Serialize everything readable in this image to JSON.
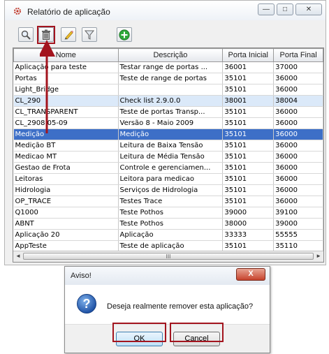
{
  "window": {
    "title": "Relatório de aplicação",
    "minimize_glyph": "—",
    "maximize_glyph": "□",
    "close_glyph": "✕"
  },
  "toolbar": {
    "buttons": [
      {
        "icon": "search-icon"
      },
      {
        "icon": "trash-icon"
      },
      {
        "icon": "edit-pencil-icon"
      },
      {
        "icon": "filter-icon"
      },
      {
        "icon": "add-icon"
      }
    ]
  },
  "table": {
    "columns": [
      "Nome",
      "Descrição",
      "Porta Inicial",
      "Porta Final"
    ],
    "rows": [
      [
        "Aplicação para teste",
        "Testar range de portas ...",
        "36001",
        "37000"
      ],
      [
        "Portas",
        "Teste de range de portas",
        "35101",
        "36000"
      ],
      [
        "Light_Bridge",
        "",
        "35101",
        "36000"
      ],
      [
        "CL_290",
        "Check list 2.9.0.0",
        "38001",
        "38004"
      ],
      [
        "CL_TRANSPARENT",
        "Teste de portas Transp...",
        "35101",
        "36000"
      ],
      [
        "CL_2908 05-09",
        "Versão 8 - Maio 2009",
        "35101",
        "36000"
      ],
      [
        "Medição",
        "Medição",
        "35101",
        "36000"
      ],
      [
        "Medição BT",
        "Leitura de Baixa Tensão",
        "35101",
        "36000"
      ],
      [
        "Medicao MT",
        "Leitura de Média Tensão",
        "35101",
        "36000"
      ],
      [
        "Gestao de Frota",
        "Controle e gerenciamen...",
        "35101",
        "36000"
      ],
      [
        "Leitoras",
        "Leitora para medicao",
        "35101",
        "36000"
      ],
      [
        "Hidrologia",
        "Serviços de Hidrologia",
        "35101",
        "36000"
      ],
      [
        "OP_TRACE",
        "Testes Trace",
        "35101",
        "36000"
      ],
      [
        "Q1000",
        "Teste Pothos",
        "39000",
        "39100"
      ],
      [
        "ABNT",
        "Teste Pothos",
        "38000",
        "39000"
      ],
      [
        "Aplicação 20",
        "Aplicação",
        "33333",
        "55555"
      ],
      [
        "AppTeste",
        "Teste de aplicação",
        "35101",
        "35110"
      ]
    ],
    "selected_row": "Medição",
    "hover_row": "CL_290",
    "scroll_left_glyph": "◄",
    "scroll_right_glyph": "►",
    "scroll_thumb_glyph": "III"
  },
  "dialog": {
    "title": "Aviso!",
    "message": "Deseja realmente remover esta aplicação?",
    "ok_label": "OK",
    "cancel_label": "Cancel",
    "close_glyph": "X",
    "icon": "question-icon"
  },
  "colors": {
    "selection": "#3d6fc7",
    "hover": "#dbe9f9",
    "annotation_red": "#a3141e"
  }
}
